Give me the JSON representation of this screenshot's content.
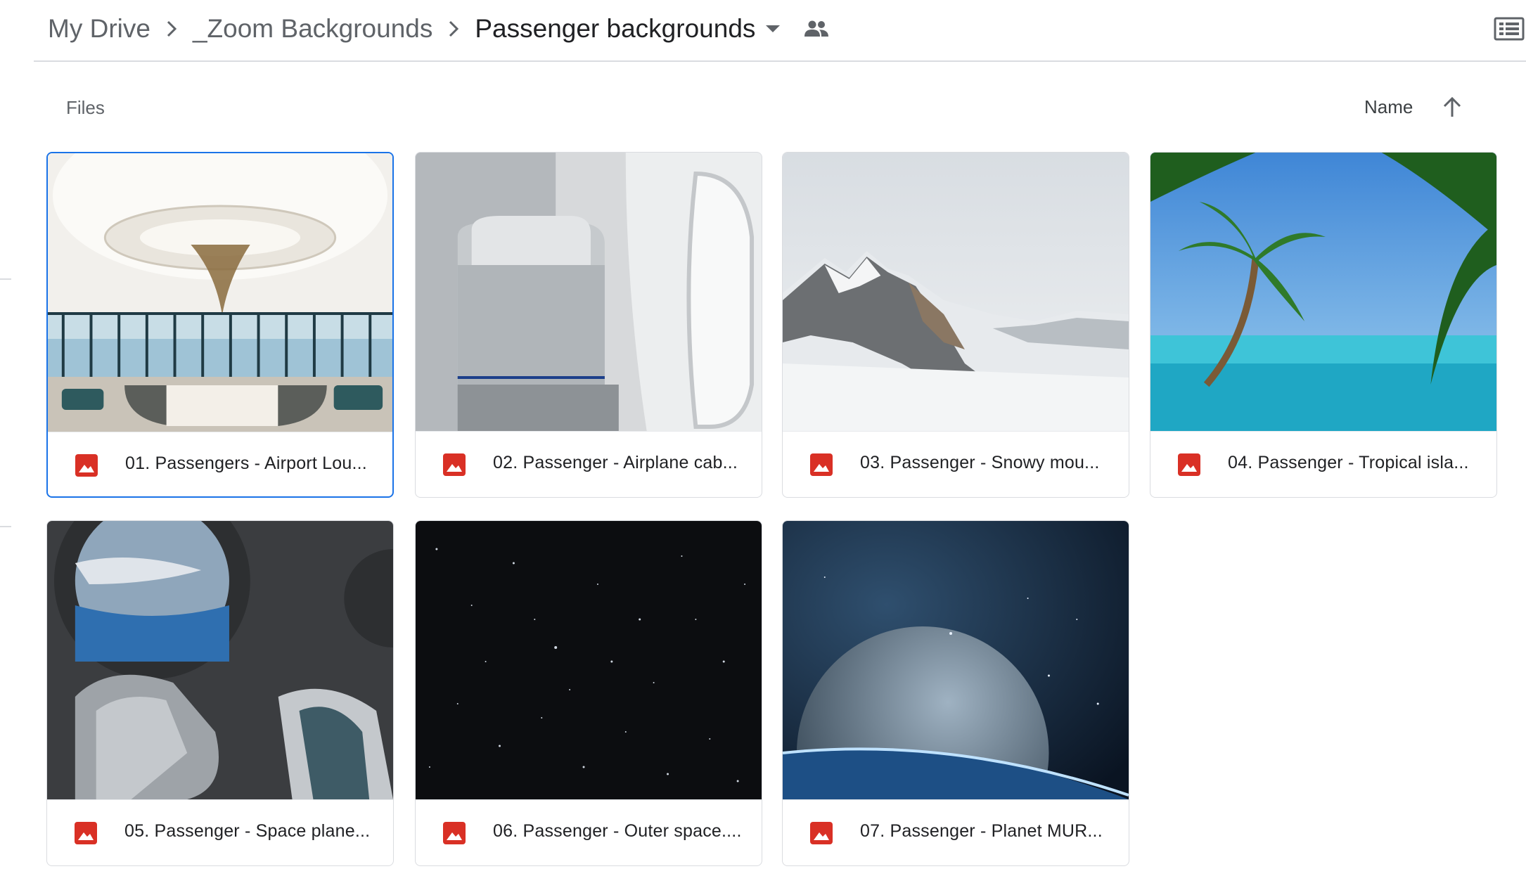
{
  "breadcrumb": {
    "items": [
      "My Drive",
      "_Zoom Backgrounds",
      "Passenger backgrounds"
    ]
  },
  "icons": {
    "separator": "chevron-right-icon",
    "dropdown": "caret-down-icon",
    "shared": "people-icon",
    "view": "list-view-icon",
    "sort": "arrow-up-icon",
    "file_type": "image-file-icon"
  },
  "section": {
    "files_label": "Files",
    "sort_label": "Name",
    "sort_direction": "ascending"
  },
  "colors": {
    "accent": "#1a73e8",
    "image_file_icon": "#d93025",
    "border": "#dadce0"
  },
  "files": [
    {
      "name": "01. Passengers - Airport Lou...",
      "selected": true
    },
    {
      "name": "02. Passenger - Airplane cab...",
      "selected": false
    },
    {
      "name": "03. Passenger - Snowy mou...",
      "selected": false
    },
    {
      "name": "04. Passenger - Tropical isla...",
      "selected": false
    },
    {
      "name": "05. Passenger - Space plane...",
      "selected": false
    },
    {
      "name": "06. Passenger - Outer space....",
      "selected": false
    },
    {
      "name": "07. Passenger - Planet MUR...",
      "selected": false
    }
  ]
}
